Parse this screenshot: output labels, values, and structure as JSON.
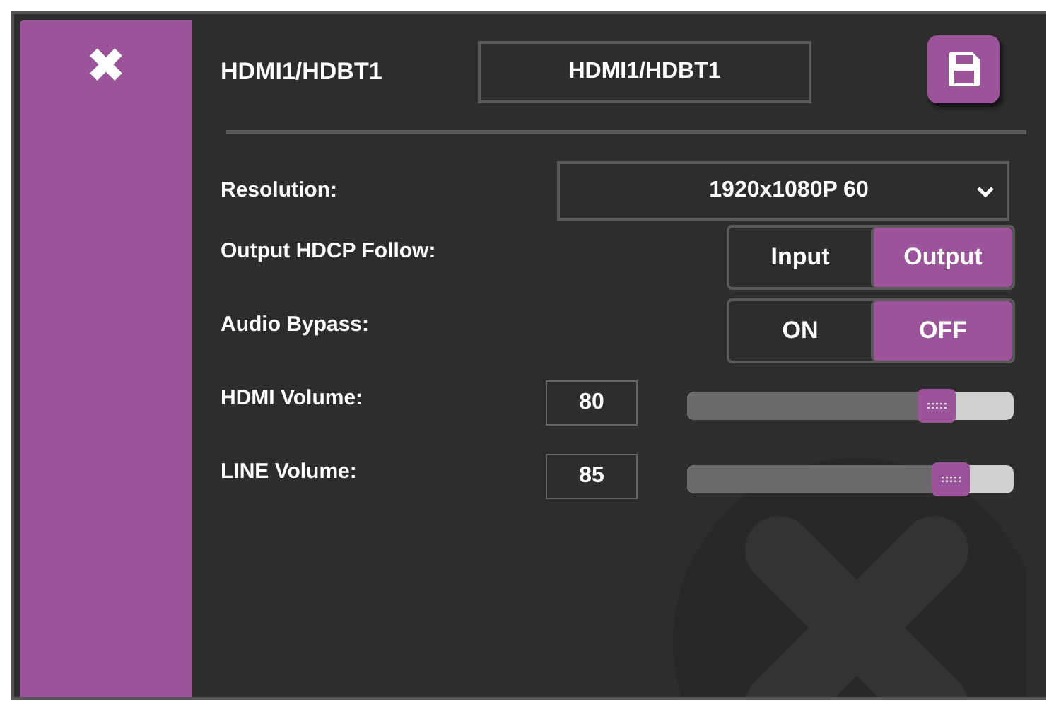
{
  "close_icon": "✖",
  "header": {
    "title": "HDMI1/HDBT1",
    "name_field": "HDMI1/HDBT1"
  },
  "settings": [
    {
      "kind": "dropdown",
      "label": "Resolution:",
      "value": "1920x1080P 60"
    },
    {
      "kind": "toggle",
      "label": "Output HDCP Follow:",
      "options": [
        {
          "label": "Input",
          "selected": false
        },
        {
          "label": "Output",
          "selected": true
        }
      ]
    },
    {
      "kind": "toggle",
      "label": "Audio Bypass:",
      "options": [
        {
          "label": "ON",
          "selected": false
        },
        {
          "label": "OFF",
          "selected": true
        }
      ]
    },
    {
      "kind": "slider",
      "label": "HDMI Volume:",
      "value": "80",
      "level": 0.8
    },
    {
      "kind": "slider",
      "label": "LINE Volume:",
      "value": "85",
      "level": 0.85
    }
  ]
}
